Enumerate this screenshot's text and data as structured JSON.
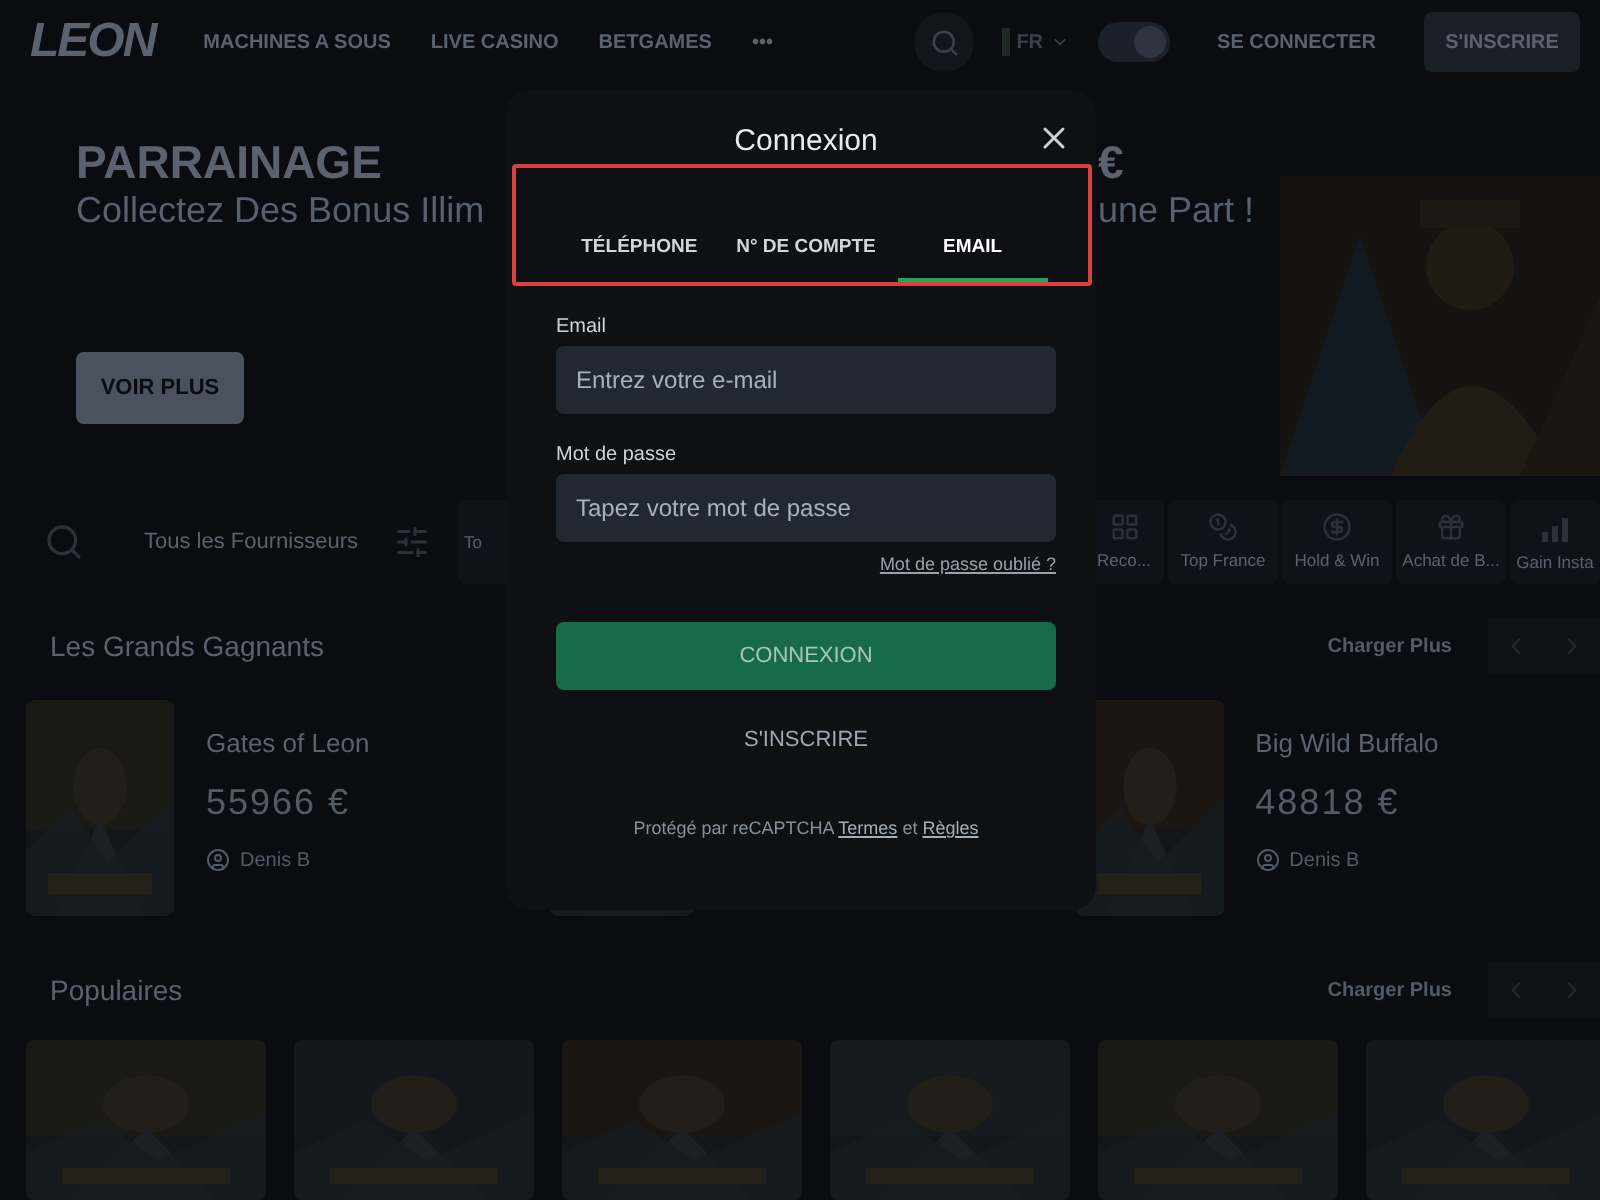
{
  "header": {
    "logo": "LEON",
    "nav": [
      "MACHINES A SOUS",
      "LIVE CASINO",
      "BETGAMES",
      "•••"
    ],
    "language": "FR",
    "dark_mode": true,
    "login": "SE CONNECTER",
    "register": "S'INSCRIRE"
  },
  "hero": {
    "title": "PARRAINAGE",
    "title_tail": "€",
    "subtitle_start": "Collectez Des Bonus Illim",
    "subtitle_end": "une Part !",
    "button": "VOIR PLUS"
  },
  "filters": {
    "providers": "Tous les Fournisseurs",
    "categories": [
      {
        "label": "To"
      },
      {
        "label": "Reco..."
      },
      {
        "label": "Top France"
      },
      {
        "label": "Hold & Win"
      },
      {
        "label": "Achat de B..."
      },
      {
        "label": "Gain Insta"
      }
    ]
  },
  "winners": {
    "title": "Les Grands Gagnants",
    "more": "Charger Plus",
    "items": [
      {
        "kind": "winner",
        "game": "Gates of Leon",
        "amount": "55966 €",
        "player": "Denis B"
      },
      {
        "kind": "picture"
      },
      {
        "kind": "winner",
        "game": "Big Wild Buffalo",
        "amount": "48818 €",
        "player": "Denis B"
      }
    ]
  },
  "popular": {
    "title": "Populaires",
    "more": "Charger Plus",
    "games": [
      {
        "kind": "picture"
      },
      {
        "kind": "picture"
      },
      {
        "kind": "picture"
      },
      {
        "kind": "picture"
      },
      {
        "kind": "picture"
      },
      {
        "kind": "picture"
      }
    ]
  },
  "modal": {
    "title": "Connexion",
    "tabs": [
      {
        "label": "TÉLÉPHONE",
        "selected": false
      },
      {
        "label": "N° DE COMPTE",
        "selected": false
      },
      {
        "label": "EMAIL",
        "selected": true
      }
    ],
    "fields": [
      {
        "label": "Email",
        "placeholder": "Entrez votre e-mail"
      },
      {
        "label": "Mot de passe",
        "placeholder": "Tapez votre mot de passe"
      }
    ],
    "forgot": "Mot de passe oublié ?",
    "submit": "CONNEXION",
    "register": "S'INSCRIRE",
    "footer": {
      "text": "Protégé par reCAPTCHA",
      "terms": "Termes",
      "and": "et",
      "rules": "Règles"
    }
  }
}
